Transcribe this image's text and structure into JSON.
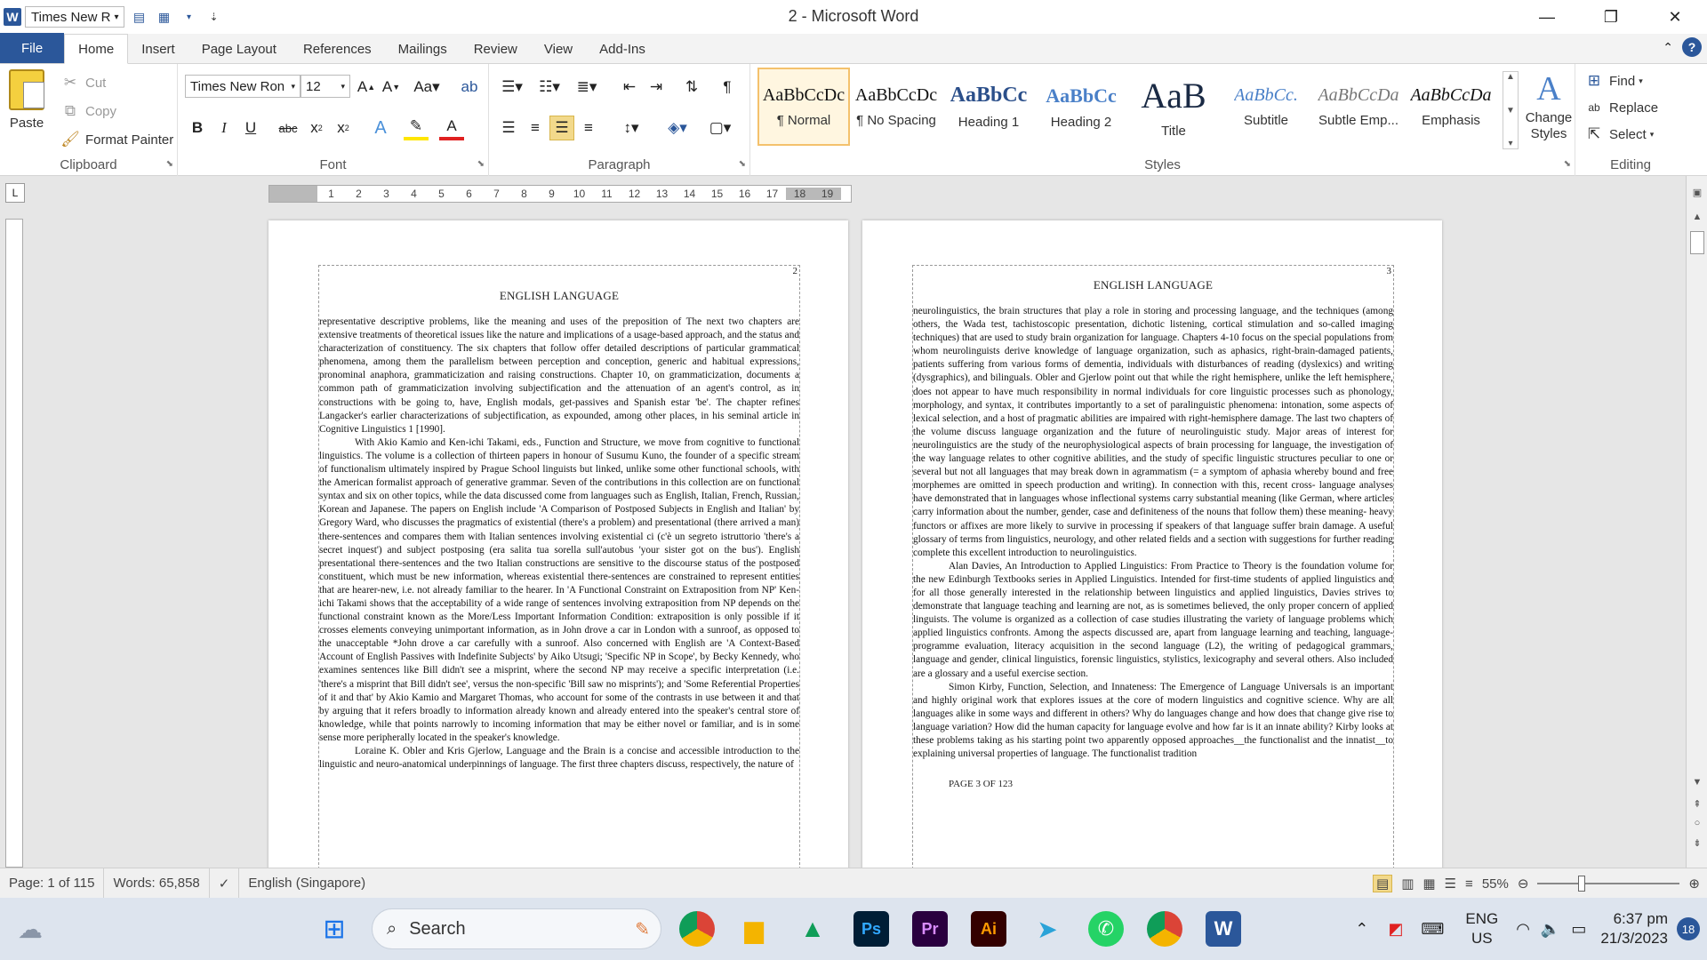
{
  "window": {
    "title": "2 - Microsoft Word",
    "qat_font": "Times New R",
    "controls": {
      "minimize": "—",
      "maximize": "❐",
      "close": "✕"
    }
  },
  "tabs": [
    "File",
    "Home",
    "Insert",
    "Page Layout",
    "References",
    "Mailings",
    "Review",
    "View",
    "Add-Ins"
  ],
  "active_tab": "Home",
  "ribbon": {
    "clipboard": {
      "label": "Clipboard",
      "paste": "Paste",
      "cut": "Cut",
      "copy": "Copy",
      "format_painter": "Format Painter"
    },
    "font": {
      "label": "Font",
      "font_name": "Times New Ron",
      "font_size": "12"
    },
    "paragraph": {
      "label": "Paragraph"
    },
    "styles": {
      "label": "Styles",
      "items": [
        {
          "sample": "AaBbCcDc",
          "name": "¶ Normal"
        },
        {
          "sample": "AaBbCcDc",
          "name": "¶ No Spacing"
        },
        {
          "sample": "AaBbCc",
          "name": "Heading 1"
        },
        {
          "sample": "AaBbCc",
          "name": "Heading 2"
        },
        {
          "sample": "AaB",
          "name": "Title"
        },
        {
          "sample": "AaBbCc.",
          "name": "Subtitle"
        },
        {
          "sample": "AaBbCcDa",
          "name": "Subtle Emp..."
        },
        {
          "sample": "AaBbCcDa",
          "name": "Emphasis"
        }
      ],
      "change_styles": "Change Styles"
    },
    "editing": {
      "label": "Editing",
      "find": "Find",
      "replace": "Replace",
      "select": "Select"
    }
  },
  "ruler": {
    "numbers": [
      "1",
      "2",
      "3",
      "4",
      "5",
      "6",
      "7",
      "8",
      "9",
      "10",
      "11",
      "12",
      "13",
      "14",
      "15",
      "16",
      "17",
      "18",
      "19"
    ]
  },
  "pages": [
    {
      "corner_num": "2",
      "header": "ENGLISH LANGUAGE",
      "paragraphs": [
        "representative descriptive problems, like the meaning and uses of the preposition of The next two chapters are extensive treatments of theoretical issues like the nature and implications of a usage-based approach, and the status and characterization of constituency. The six chapters that follow offer detailed descriptions of particular grammatical phenomena, among them the parallelism between perception and conception, generic and habitual expressions, pronominal anaphora, grammaticization and raising constructions. Chapter 10, on grammaticization, documents a common path of grammaticization involving subjectification and the attenuation of an agent's control, as in constructions with be going to, have, English modals, get-passives and Spanish estar 'be'. The chapter refines Langacker's earlier characterizations of subjectification, as expounded, among other places, in his seminal article in Cognitive Linguistics 1 [1990].",
        "With Akio Kamio and Ken-ichi Takami, eds., Function and Structure, we move from cognitive to functional linguistics. The volume is a collection of thirteen papers in honour of Susumu Kuno, the founder of a specific stream of functionalism ultimately inspired by Prague School linguists but linked, unlike some other functional schools, with the American formalist approach of generative grammar. Seven of the contributions in this collection are on functional syntax and six on other topics, while the data discussed come from languages such as English, Italian, French, Russian, Korean and Japanese. The papers on English include 'A Comparison of Postposed Subjects in English and Italian' by Gregory Ward, who discusses the pragmatics of existential (there's a problem) and presentational (there arrived a man) there-sentences and compares them with Italian sentences involving existential ci (c'è un segreto istruttorio 'there's a secret inquest') and subject postposing (era salita tua sorella sull'autobus 'your sister got on the bus'). English presentational there-sentences and the two Italian constructions are sensitive to the discourse status of the postposed constituent, which must be new information, whereas existential there-sentences are constrained to represent entities that are hearer-new, i.e. not already familiar to the hearer. In 'A Functional Constraint on Extraposition from NP' Ken-ichi Takami shows that the acceptability of a wide range of sentences involving extraposition from NP depends on the functional constraint known as the More/Less Important Information Condition: extraposition is only possible if it crosses elements conveying unimportant information, as in John drove a car in London with a sunroof, as opposed to the unacceptable *John drove a car carefully with a sunroof. Also concerned with English are 'A Context-Based Account of English Passives with Indefinite Subjects' by Aiko Utsugi; 'Specific NP in Scope', by Becky Kennedy, who examines sentences like Bill didn't see a misprint, where the second NP may receive a specific interpretation (i.e. 'there's a misprint that Bill didn't see', versus the non-specific 'Bill saw no misprints'); and 'Some Referential Properties of it and that' by Akio Kamio and Margaret Thomas, who account for some of the contrasts in use between it and that by arguing that it refers broadly to information already known and already entered into the speaker's central store of knowledge, while that points narrowly to incoming information that may be either novel or familiar, and is in some sense more peripherally located in the speaker's knowledge.",
        "Loraine K. Obler and Kris Gjerlow, Language and the Brain is a concise and accessible introduction to the linguistic and neuro-anatomical underpinnings of language. The first three chapters discuss, respectively, the nature of"
      ],
      "footer": ""
    },
    {
      "corner_num": "3",
      "header": "ENGLISH LANGUAGE",
      "paragraphs": [
        "neurolinguistics, the brain structures that play a role in storing and processing language, and the techniques (among others, the Wada test, tachistoscopic presentation, dichotic listening, cortical stimulation and so-called imaging techniques) that are used to study brain organization for language. Chapters 4-10 focus on the special populations from whom neurolinguists derive knowledge of language organization, such as aphasics, right-brain-damaged patients, patients suffering from various forms of dementia, individuals with disturbances of reading (dyslexics) and writing (dysgraphics), and bilinguals. Obler and Gjerlow point out that while the right hemisphere, unlike the left hemisphere, does not appear to have much responsibility in normal individuals for core linguistic processes such as phonology, morphology, and syntax, it contributes importantly to a set of paralinguistic phenomena: intonation, some aspects of lexical selection, and a host of pragmatic abilities are impaired with right-hemisphere damage. The last two chapters of the volume discuss language organization and the future of neurolinguistic study. Major areas of interest for neurolinguistics are the study of the neurophysiological aspects of brain processing for language, the investigation of the way language relates to other cognitive abilities, and the study of specific linguistic structures peculiar to one or several but not all languages that may break down in agrammatism (= a symptom of aphasia whereby bound and free morphemes are omitted in speech production and writing). In connection with this, recent cross- language analyses have demonstrated that in languages whose inflectional systems carry substantial meaning (like German, where articles carry information about the number, gender, case and definiteness of the nouns that follow them) these meaning- heavy functors or affixes are more likely to survive in processing if speakers of that language suffer brain damage. A useful glossary of terms from linguistics, neurology, and other related fields and a section with suggestions for further reading complete this excellent introduction to neurolinguistics.",
        "Alan Davies, An Introduction to Applied Linguistics: From Practice to Theory is the foundation volume for the new Edinburgh Textbooks series in Applied Linguistics. Intended for first-time students of applied linguistics and for all those generally interested in the relationship between linguistics and applied linguistics, Davies strives to demonstrate that language teaching and learning are not, as is sometimes believed, the only proper concern of applied linguists. The volume is organized as a collection of case studies illustrating the variety of language problems which applied linguistics confronts. Among the aspects discussed are, apart from language learning and teaching, language-programme evaluation, literacy acquisition in the second language (L2), the writing of pedagogical grammars, language and gender, clinical linguistics, forensic linguistics, stylistics, lexicography and several others. Also included are a glossary and a useful exercise section.",
        "Simon Kirby, Function, Selection, and Innateness: The Emergence of Language Universals is an important and highly original work that explores issues at the core of modern linguistics and cognitive science. Why are all languages alike in some ways and different in others? Why do languages change and how does that change give rise to language variation? How did the human capacity for language evolve and how far is it an innate ability? Kirby looks at these problems taking as his starting point two apparently opposed approaches__the functionalist and the innatist__to explaining universal properties of language. The functionalist tradition"
      ],
      "footer": "PAGE 3 OF 123"
    }
  ],
  "status": {
    "page": "Page: 1 of 115",
    "words": "Words: 65,858",
    "language": "English (Singapore)",
    "zoom": "55%",
    "zoom_fraction": 0.3
  },
  "taskbar": {
    "search": "Search",
    "lang_top": "ENG",
    "lang_bottom": "US",
    "time": "6:37 pm",
    "date": "21/3/2023",
    "badge": "18",
    "apps": [
      "chrome",
      "files",
      "drive",
      "photoshop",
      "premiere",
      "illustrator",
      "telegram",
      "whatsapp",
      "chrome-2",
      "word"
    ]
  },
  "colors": {
    "word_blue": "#2b579a",
    "style_selected": "#f4c16c"
  }
}
